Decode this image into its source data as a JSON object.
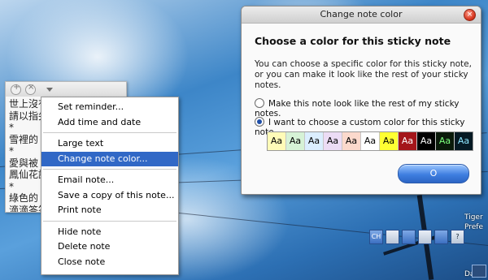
{
  "sticky_note": {
    "text_lines": [
      "世上沒有",
      "請以指尖",
      "*",
      "雪裡的",
      "*",
      "愛與被",
      "鳳仙花謊",
      "*",
      "綠色的",
      "滴滴答答"
    ]
  },
  "context_menu": {
    "groups": [
      [
        "Set reminder...",
        "Add time and date"
      ],
      [
        "Large text",
        "Change note color..."
      ],
      [
        "Email note...",
        "Save a copy of this note...",
        "Print note"
      ],
      [
        "Hide note",
        "Delete note",
        "Close note"
      ]
    ],
    "highlighted": "Change note color..."
  },
  "dialog": {
    "title": "Change note color",
    "heading": "Choose a color for this sticky note",
    "description": "You can choose a specific color for this sticky note, or you can make it look like the rest of your sticky notes.",
    "option_default": "Make this note look like the rest of my sticky notes.",
    "option_custom": "I want to choose a custom color for this sticky note.",
    "selected_option": "custom",
    "swatch_label": "Aa",
    "swatches": [
      {
        "bg": "#fffbb8",
        "fg": "#000000"
      },
      {
        "bg": "#d6f2d6",
        "fg": "#000000"
      },
      {
        "bg": "#dbeeff",
        "fg": "#000000"
      },
      {
        "bg": "#ecdcf5",
        "fg": "#000000"
      },
      {
        "bg": "#fbd9cc",
        "fg": "#000000"
      },
      {
        "bg": "#ffffff",
        "fg": "#000000"
      },
      {
        "bg": "#ffff33",
        "fg": "#000000"
      },
      {
        "bg": "#a4161a",
        "fg": "#ffffff"
      },
      {
        "bg": "#000000",
        "fg": "#ffffff"
      },
      {
        "bg": "#0a1a0a",
        "fg": "#7cff7c"
      },
      {
        "bg": "#061a24",
        "fg": "#8fe6ff"
      }
    ],
    "ok_label": "O"
  },
  "taskbar": {
    "lang": "CH",
    "side_labels": [
      "Tiger",
      "Prefe",
      "Dapp"
    ]
  }
}
